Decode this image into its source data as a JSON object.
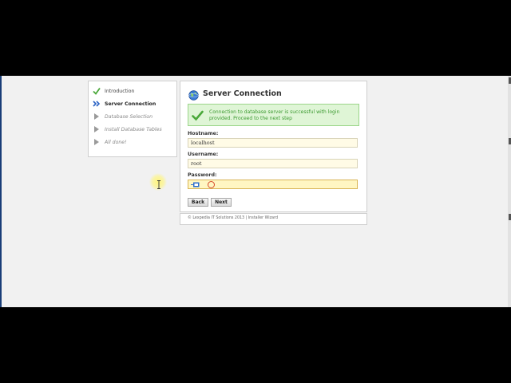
{
  "steps": [
    {
      "label": "Introduction",
      "state": "done",
      "icon": "check-icon"
    },
    {
      "label": "Server Connection",
      "state": "active",
      "icon": "double-chevron-icon"
    },
    {
      "label": "Database Selection",
      "state": "pending",
      "icon": "arrow-right-icon"
    },
    {
      "label": "Install Database Tables",
      "state": "pending",
      "icon": "arrow-right-icon"
    },
    {
      "label": "All done!",
      "state": "pending",
      "icon": "arrow-right-icon"
    }
  ],
  "panel": {
    "title": "Server Connection",
    "title_icon": "globe-icon",
    "alert": {
      "icon": "check-icon",
      "message": "Connection to database server is successful with login provided. Proceed to the next step"
    },
    "fields": {
      "hostname": {
        "label": "Hostname:",
        "value": "localhost"
      },
      "username": {
        "label": "Username:",
        "value": "root"
      },
      "password": {
        "label": "Password:",
        "value": ""
      }
    },
    "buttons": {
      "back": "Back",
      "next": "Next"
    }
  },
  "footer": {
    "text": "© Lexpedia IT Solutions 2013 | Installer Wizard"
  },
  "colors": {
    "alert_bg": "#dff5d6",
    "alert_text": "#3c9a31",
    "field_bg": "#fffbe6",
    "check_green": "#4aa83a"
  }
}
